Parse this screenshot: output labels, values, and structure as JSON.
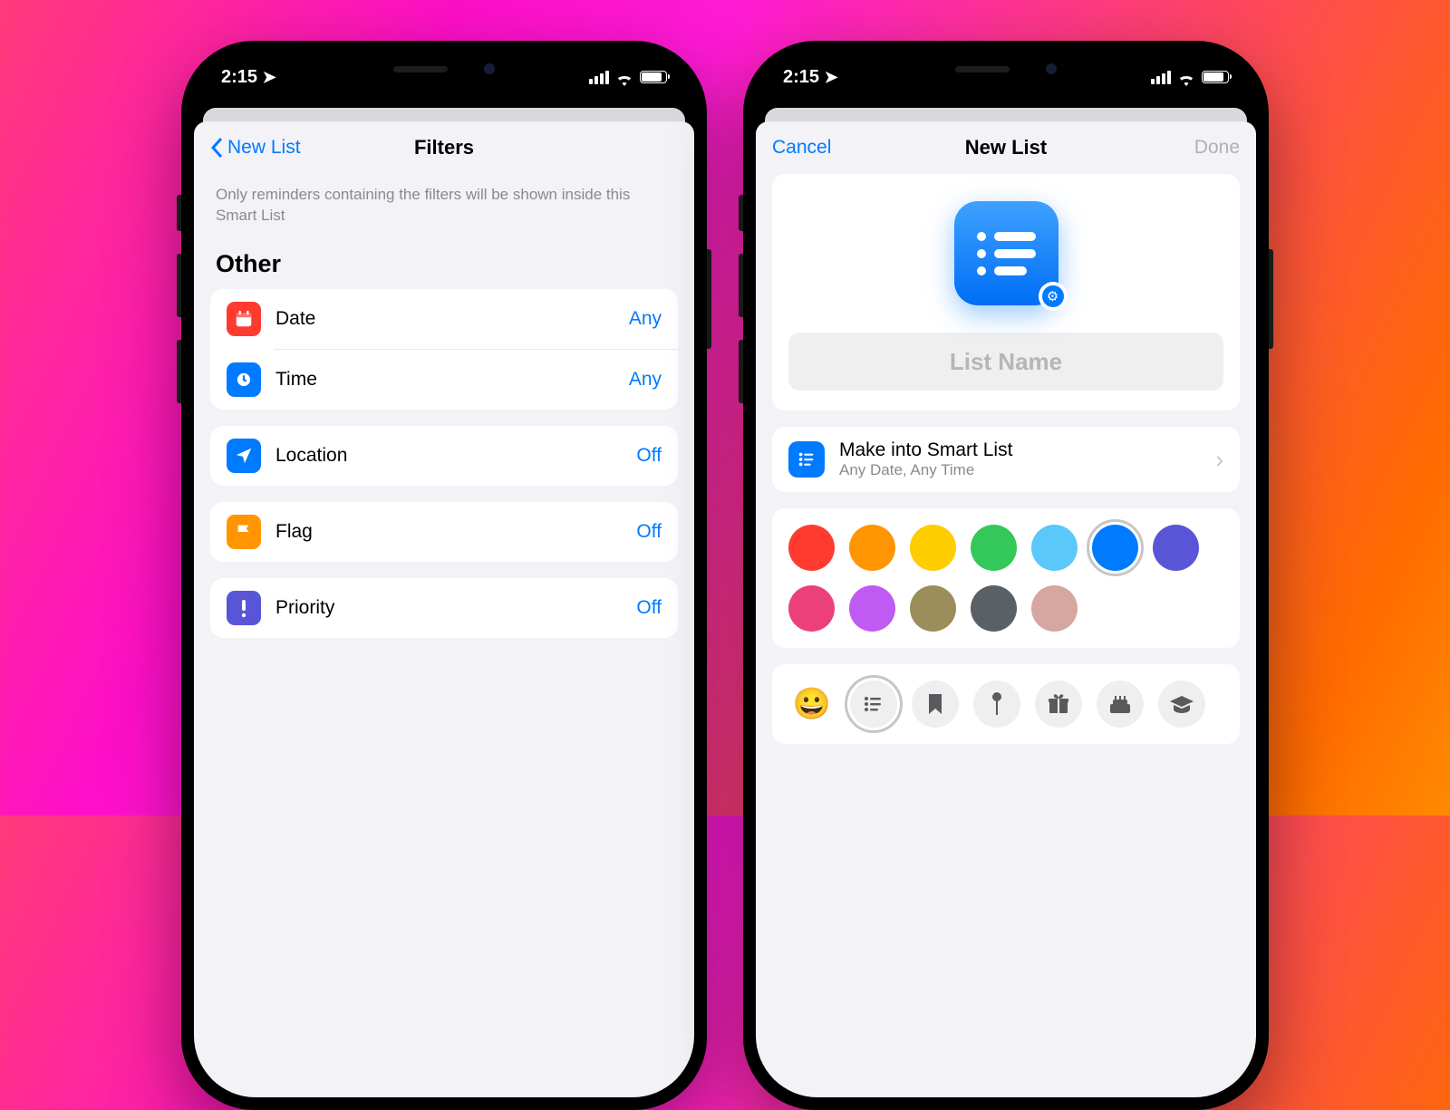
{
  "status": {
    "time": "2:15"
  },
  "phone1": {
    "nav": {
      "back": "New List",
      "title": "Filters"
    },
    "description": "Only reminders containing the filters will be shown inside this Smart List",
    "section_header": "Other",
    "filters": [
      {
        "icon": "calendar-icon",
        "color": "ic-red",
        "label": "Date",
        "value": "Any"
      },
      {
        "icon": "clock-icon",
        "color": "ic-blue",
        "label": "Time",
        "value": "Any"
      },
      {
        "icon": "location-icon",
        "color": "ic-blue",
        "label": "Location",
        "value": "Off"
      },
      {
        "icon": "flag-icon",
        "color": "ic-orange",
        "label": "Flag",
        "value": "Off"
      },
      {
        "icon": "priority-icon",
        "color": "ic-purple",
        "label": "Priority",
        "value": "Off"
      }
    ]
  },
  "phone2": {
    "nav": {
      "cancel": "Cancel",
      "title": "New List",
      "done": "Done"
    },
    "list_name_placeholder": "List Name",
    "smart": {
      "title": "Make into Smart List",
      "subtitle": "Any Date, Any Time"
    },
    "colors": [
      {
        "hex": "#ff3b30",
        "selected": false
      },
      {
        "hex": "#ff9500",
        "selected": false
      },
      {
        "hex": "#ffcc00",
        "selected": false
      },
      {
        "hex": "#34c759",
        "selected": false
      },
      {
        "hex": "#5ac8fa",
        "selected": false
      },
      {
        "hex": "#007aff",
        "selected": true
      },
      {
        "hex": "#5856d6",
        "selected": false
      },
      {
        "hex": "#ec407a",
        "selected": false
      },
      {
        "hex": "#bf5af2",
        "selected": false
      },
      {
        "hex": "#9c8e5a",
        "selected": false
      },
      {
        "hex": "#5a6066",
        "selected": false
      },
      {
        "hex": "#d6a6a0",
        "selected": false
      }
    ],
    "icons": [
      {
        "name": "emoji-icon",
        "glyph": "😀",
        "emoji": true,
        "selected": false
      },
      {
        "name": "list-icon",
        "glyph": "",
        "emoji": false,
        "selected": true
      },
      {
        "name": "bookmark-icon",
        "glyph": "🔖",
        "emoji": false,
        "selected": false
      },
      {
        "name": "pin-icon",
        "glyph": "📍",
        "emoji": false,
        "selected": false
      },
      {
        "name": "gift-icon",
        "glyph": "🎁",
        "emoji": false,
        "selected": false
      },
      {
        "name": "cake-icon",
        "glyph": "🎂",
        "emoji": false,
        "selected": false
      },
      {
        "name": "graduation-icon",
        "glyph": "🎓",
        "emoji": false,
        "selected": false
      }
    ]
  }
}
